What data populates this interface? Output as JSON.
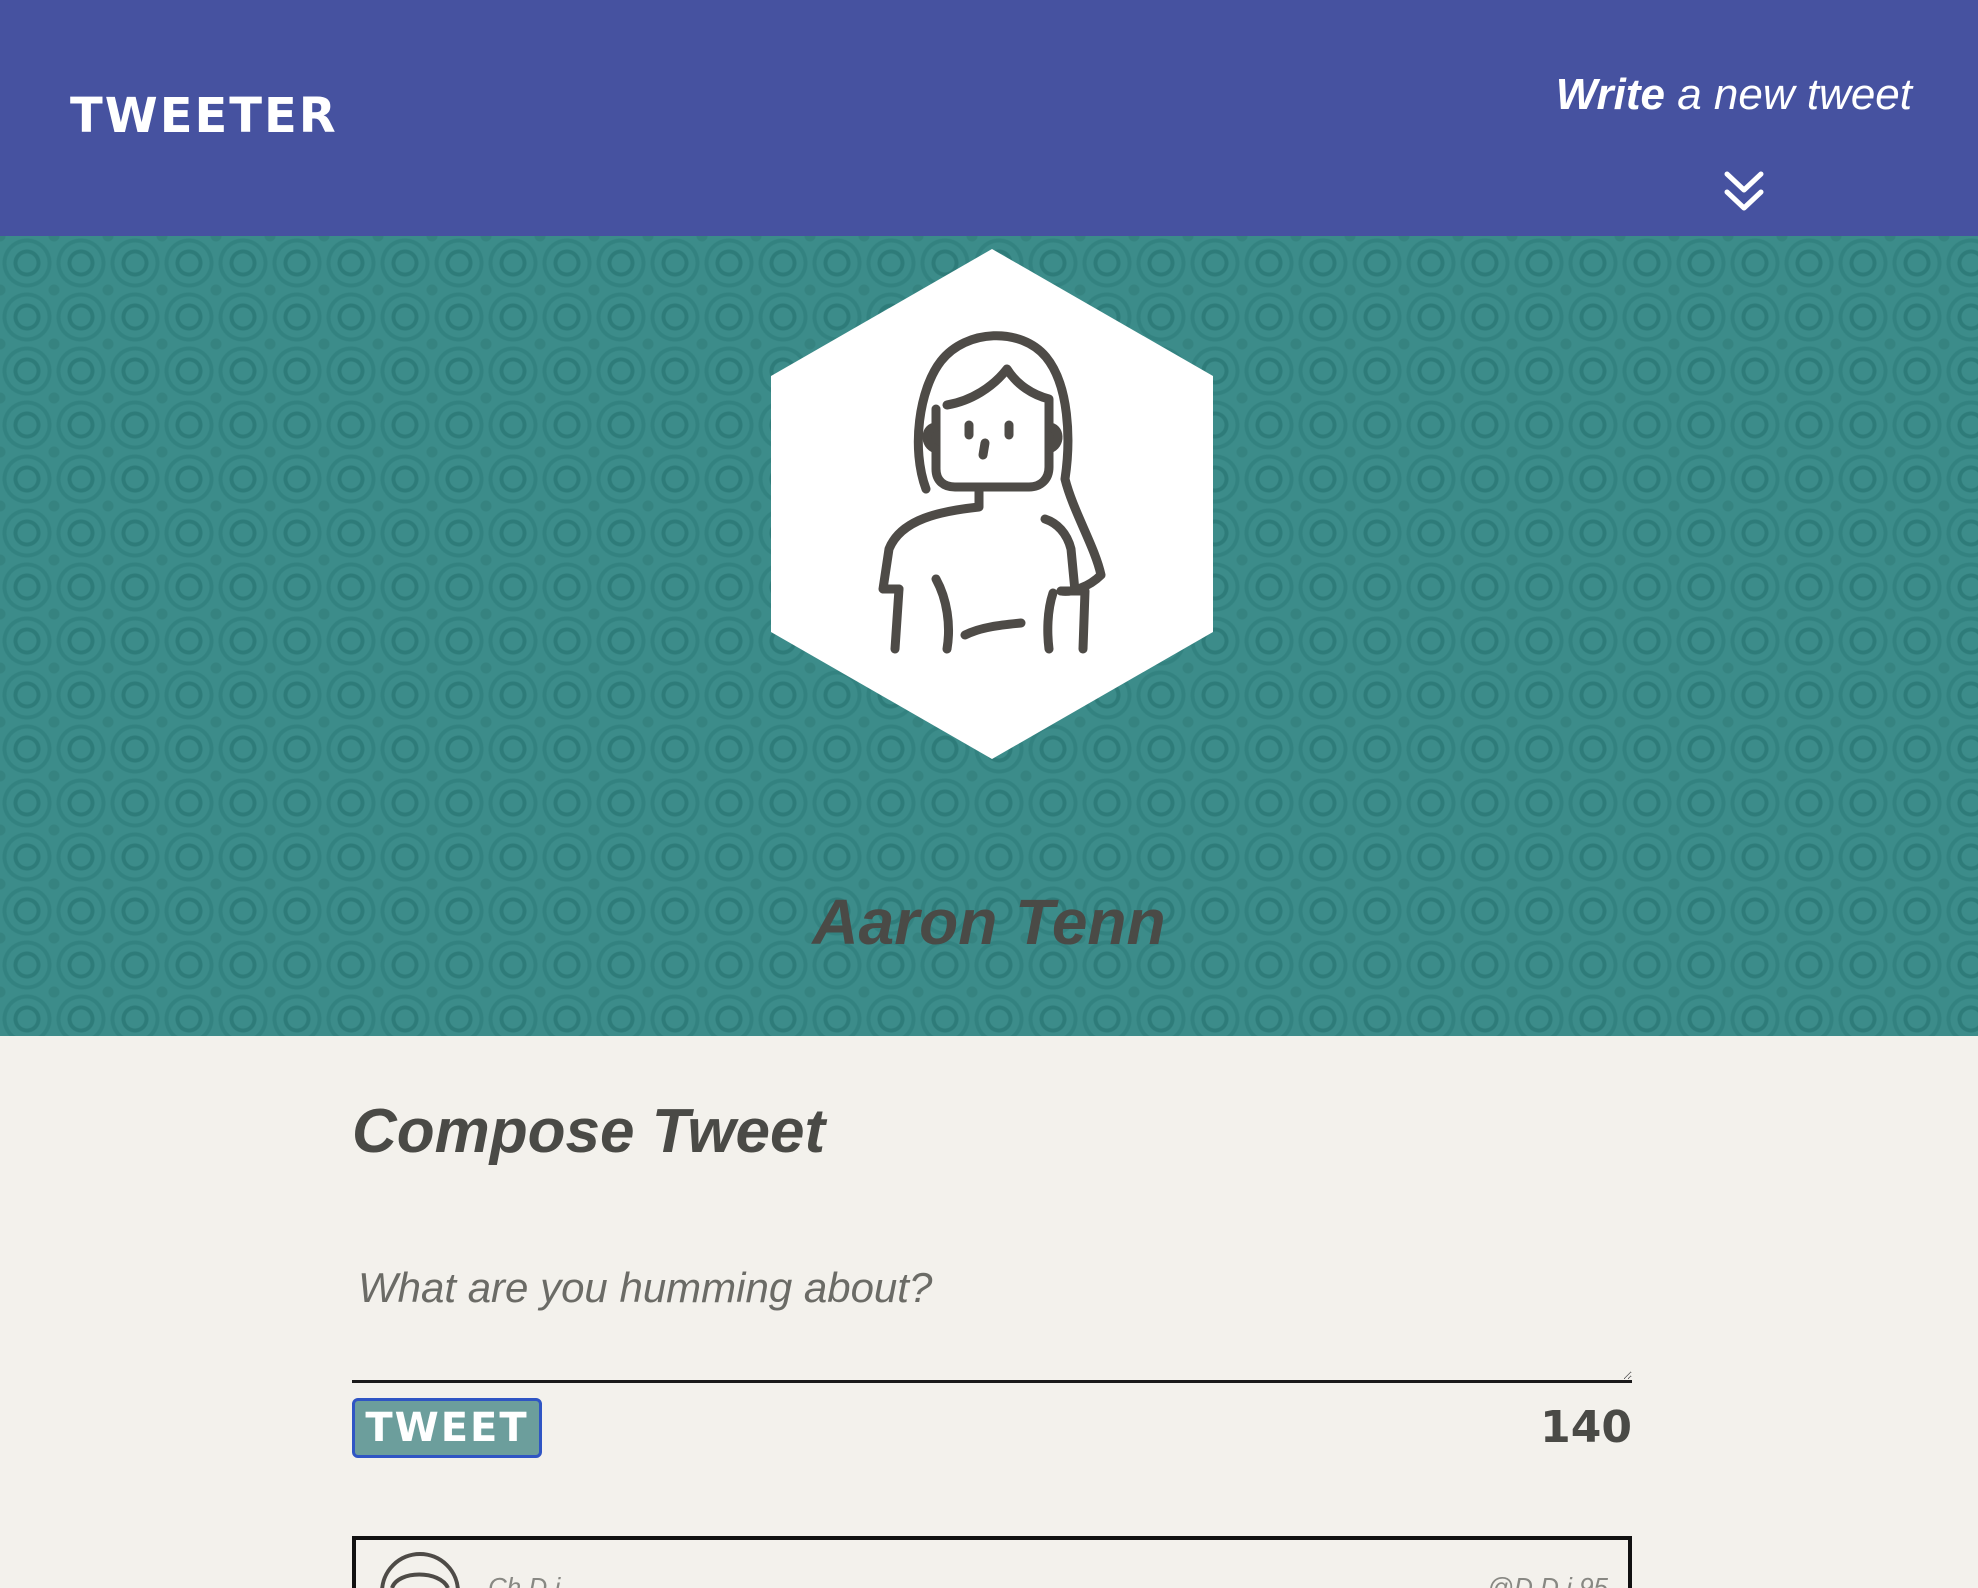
{
  "nav": {
    "brand": "TWEETER",
    "compose_cta_bold": "Write",
    "compose_cta_rest": " a new tweet",
    "toggle_icon": "double-chevron-down-icon"
  },
  "profile": {
    "name": "Aaron Tenn",
    "avatar_icon": "woman-avatar-icon"
  },
  "compose": {
    "title": "Compose Tweet",
    "placeholder": "What are you humming about?",
    "value": "",
    "tweet_button_label": "TWEET",
    "char_count": "140"
  },
  "tweets": [
    {
      "name": "Ch  D  i",
      "handle": "@D  D  i    95",
      "avatar_icon": "user-avatar-icon"
    }
  ],
  "colors": {
    "nav_bg": "#4652a0",
    "hero_bg": "#3c8c8a",
    "page_bg": "#f3f1ec",
    "text_dark": "#4a4a46",
    "tweet_button_bg": "#6c9e9c",
    "focus_ring": "#2f55c4"
  }
}
